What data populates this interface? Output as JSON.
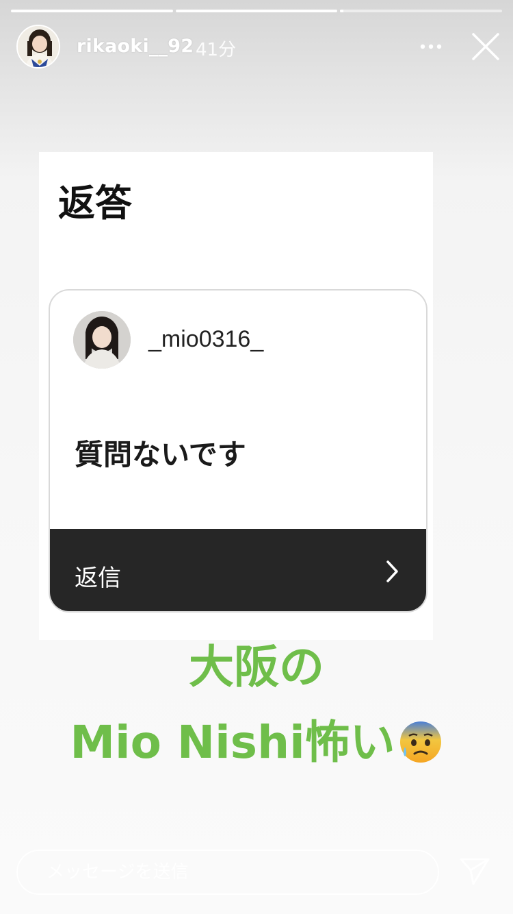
{
  "story": {
    "progress": [
      1,
      1,
      0.02
    ],
    "header": {
      "username": "rikaoki__92",
      "timestamp": "41分",
      "more_icon": "more-dots-icon",
      "close_icon": "close-icon"
    }
  },
  "content": {
    "card_title": "返答",
    "question": {
      "username": "_mio0316_",
      "text": "質問ないです",
      "reply_label": "返信",
      "chevron_icon": "chevron-right-icon"
    },
    "caption": {
      "line1": "大阪の",
      "line2": "Mio Nishi怖い",
      "emoji": "anxious-face-with-sweat-emoji",
      "color": "#6fbe4a"
    }
  },
  "footer": {
    "message_placeholder": "メッセージを送信",
    "send_icon": "send-icon"
  }
}
